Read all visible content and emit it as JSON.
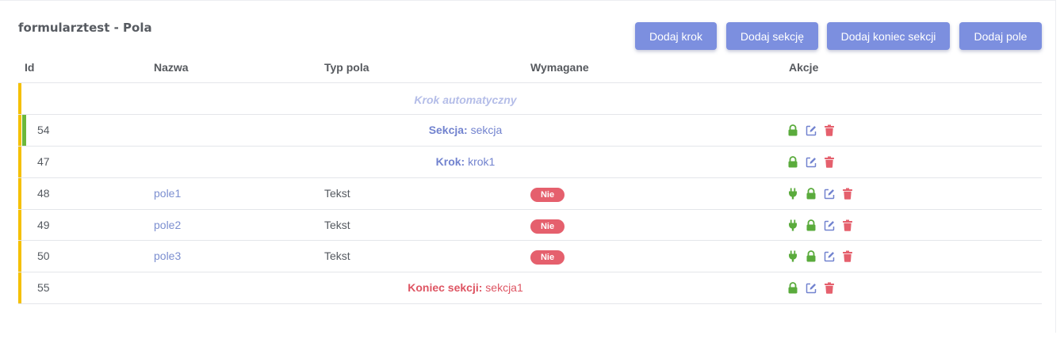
{
  "header": {
    "title": "formularztest - Pola",
    "buttons": {
      "add_step": "Dodaj krok",
      "add_section": "Dodaj sekcję",
      "add_section_end": "Dodaj koniec sekcji",
      "add_field": "Dodaj pole"
    }
  },
  "table": {
    "columns": [
      "Id",
      "Nazwa",
      "Typ pola",
      "Wymagane",
      "Akcje"
    ],
    "auto_step_label": "Krok automatyczny",
    "rows": [
      {
        "id": "54",
        "kind_label": "Sekcja:",
        "kind_value": "sekcja"
      },
      {
        "id": "47",
        "kind_label": "Krok:",
        "kind_value": "krok1"
      },
      {
        "id": "48",
        "name": "pole1",
        "type": "Tekst",
        "required": "Nie"
      },
      {
        "id": "49",
        "name": "pole2",
        "type": "Tekst",
        "required": "Nie"
      },
      {
        "id": "50",
        "name": "pole3",
        "type": "Tekst",
        "required": "Nie"
      },
      {
        "id": "55",
        "kind_label": "Koniec sekcji:",
        "kind_value": "sekcja1"
      }
    ]
  },
  "colors": {
    "accent": "#7c8fdf",
    "step_bar": "#f5c000",
    "section_bar": "#6cb83a",
    "badge_no": "#e5606d",
    "lock": "#5aab3c",
    "edit": "#7283cf",
    "delete": "#e5606d"
  },
  "icons": [
    "plug-icon",
    "lock-icon",
    "edit-icon",
    "trash-icon"
  ]
}
